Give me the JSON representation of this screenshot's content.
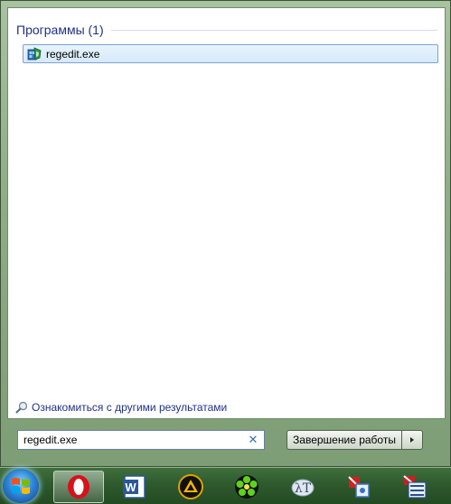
{
  "start_menu": {
    "group": {
      "title": "Программы (1)"
    },
    "results": [
      {
        "label": "regedit.exe",
        "icon": "regedit-icon"
      }
    ],
    "more_results": {
      "label": "Ознакомиться с другими результатами",
      "icon": "magnifier-icon"
    },
    "search": {
      "value": "regedit.exe",
      "clear_icon": "clear-search-icon"
    },
    "shutdown": {
      "label": "Завершение работы",
      "arrow_icon": "chevron-right-icon"
    }
  },
  "taskbar": {
    "start_button": "windows-start-orb",
    "items": [
      {
        "name": "opera",
        "icon": "opera-icon"
      },
      {
        "name": "microsoft-word",
        "icon": "word-icon"
      },
      {
        "name": "aimp",
        "icon": "aimp-icon"
      },
      {
        "name": "icq",
        "icon": "icq-icon"
      },
      {
        "name": "lambda-app",
        "icon": "lambda-icon"
      },
      {
        "name": "regedit-tool",
        "icon": "tool-icon"
      },
      {
        "name": "network-tool",
        "icon": "network-icon"
      }
    ]
  },
  "colors": {
    "accent": "#1e3287",
    "selection_bg": "#d6e9fb",
    "selection_border": "#7da2ce",
    "taskbar": "#2e5a2d"
  }
}
